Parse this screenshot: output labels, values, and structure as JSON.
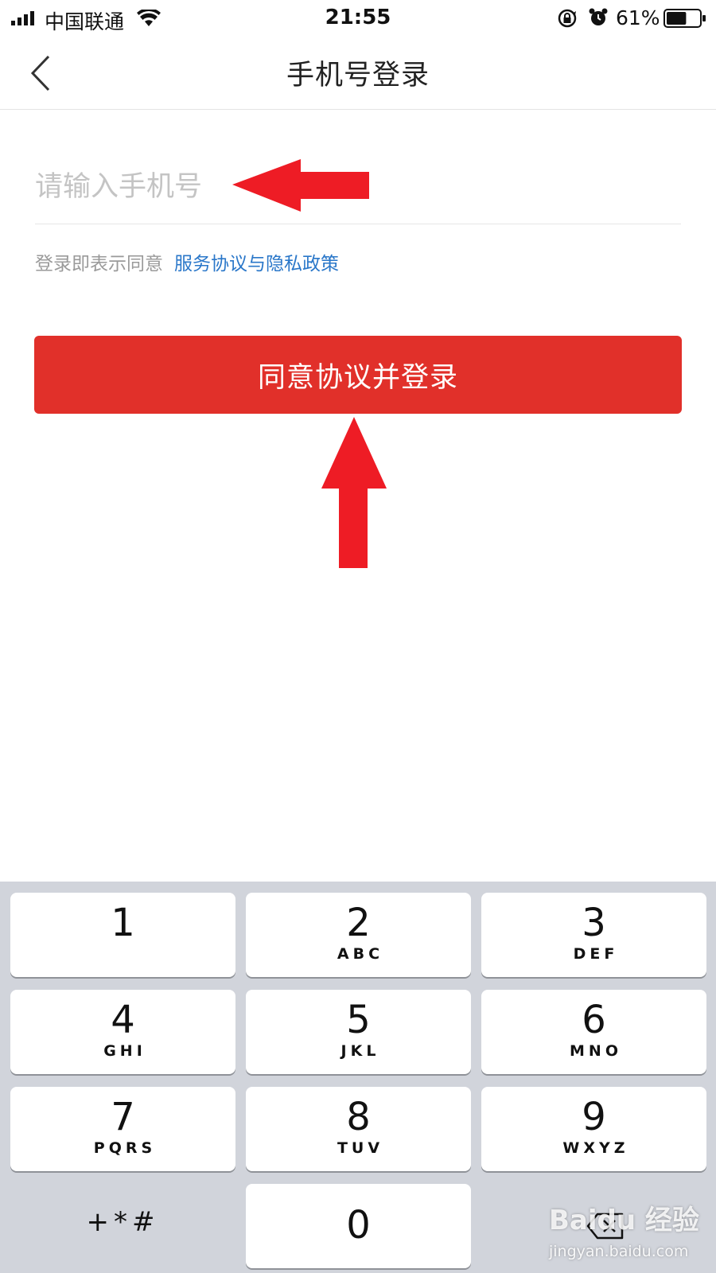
{
  "status_bar": {
    "carrier": "中国联通",
    "time": "21:55",
    "battery_percent": "61%",
    "battery_level": 0.61,
    "signal_icon": "signal-bars-icon",
    "wifi_icon": "wifi-icon",
    "lock_icon": "orientation-lock-icon",
    "alarm_icon": "alarm-clock-icon"
  },
  "nav": {
    "back_icon": "chevron-left-icon",
    "title": "手机号登录"
  },
  "login_form": {
    "phone_placeholder": "请输入手机号",
    "phone_value": "",
    "agreement_text": "登录即表示同意",
    "agreement_link": "服务协议与隐私政策",
    "submit_label": "同意协议并登录"
  },
  "keypad": {
    "keys": [
      {
        "digit": "1",
        "letters": ""
      },
      {
        "digit": "2",
        "letters": "ABC"
      },
      {
        "digit": "3",
        "letters": "DEF"
      },
      {
        "digit": "4",
        "letters": "GHI"
      },
      {
        "digit": "5",
        "letters": "JKL"
      },
      {
        "digit": "6",
        "letters": "MNO"
      },
      {
        "digit": "7",
        "letters": "PQRS"
      },
      {
        "digit": "8",
        "letters": "TUV"
      },
      {
        "digit": "9",
        "letters": "WXYZ"
      },
      {
        "digit": "0",
        "letters": ""
      }
    ],
    "symbols_label": "+*#",
    "delete_icon": "backspace-icon"
  },
  "annotations": {
    "arrow_color": "#ee1c25"
  },
  "watermark": {
    "logo": "Baidu 经验",
    "url": "jingyan.baidu.com"
  },
  "colors": {
    "accent_red": "#e1302a",
    "link_blue": "#2a77c9",
    "keypad_bg": "#d1d4db"
  }
}
